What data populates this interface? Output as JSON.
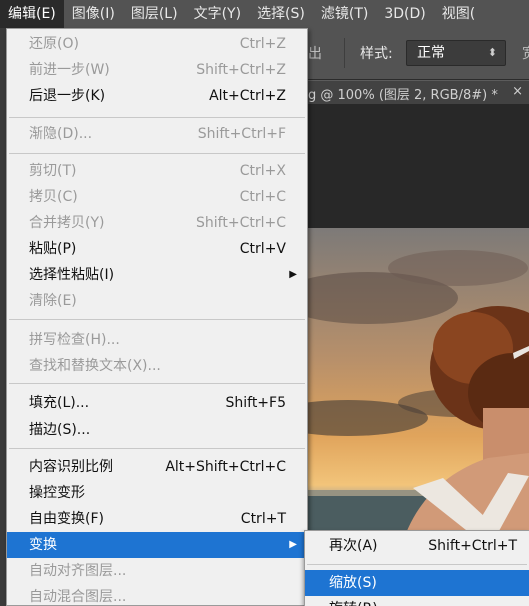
{
  "menubar": {
    "items": [
      "编辑(E)",
      "图像(I)",
      "图层(L)",
      "文字(Y)",
      "选择(S)",
      "滤镜(T)",
      "3D(D)",
      "视图("
    ]
  },
  "options_bar": {
    "fragment": "出",
    "style_label": "样式:",
    "style_value": "正常",
    "extra": "宽"
  },
  "document_tab": {
    "title": "g @ 100% (图层 2, RGB/8#) *",
    "close": "×"
  },
  "edit_menu": {
    "undo": {
      "label": "还原(O)",
      "shortcut": "Ctrl+Z"
    },
    "step_forward": {
      "label": "前进一步(W)",
      "shortcut": "Shift+Ctrl+Z"
    },
    "step_backward": {
      "label": "后退一步(K)",
      "shortcut": "Alt+Ctrl+Z"
    },
    "fade": {
      "label": "渐隐(D)...",
      "shortcut": "Shift+Ctrl+F"
    },
    "cut": {
      "label": "剪切(T)",
      "shortcut": "Ctrl+X"
    },
    "copy": {
      "label": "拷贝(C)",
      "shortcut": "Ctrl+C"
    },
    "copy_merged": {
      "label": "合并拷贝(Y)",
      "shortcut": "Shift+Ctrl+C"
    },
    "paste": {
      "label": "粘贴(P)",
      "shortcut": "Ctrl+V"
    },
    "paste_special": {
      "label": "选择性粘贴(I)"
    },
    "clear": {
      "label": "清除(E)"
    },
    "check_spelling": {
      "label": "拼写检查(H)..."
    },
    "find_replace": {
      "label": "查找和替换文本(X)..."
    },
    "fill": {
      "label": "填充(L)...",
      "shortcut": "Shift+F5"
    },
    "stroke": {
      "label": "描边(S)..."
    },
    "content_aware_scale": {
      "label": "内容识别比例",
      "shortcut": "Alt+Shift+Ctrl+C"
    },
    "puppet_warp": {
      "label": "操控变形"
    },
    "free_transform": {
      "label": "自由变换(F)",
      "shortcut": "Ctrl+T"
    },
    "transform": {
      "label": "变换"
    },
    "auto_align": {
      "label": "自动对齐图层..."
    },
    "auto_blend": {
      "label": "自动混合图层..."
    }
  },
  "transform_submenu": {
    "again": {
      "label": "再次(A)",
      "shortcut": "Shift+Ctrl+T"
    },
    "scale": {
      "label": "缩放(S)"
    },
    "rotate": {
      "label": "旋转(R)"
    }
  },
  "colors": {
    "menu_bg": "#f0f0f0",
    "highlight": "#1e74d2",
    "disabled_text": "#9a9a9a",
    "app_bar": "#535353"
  }
}
